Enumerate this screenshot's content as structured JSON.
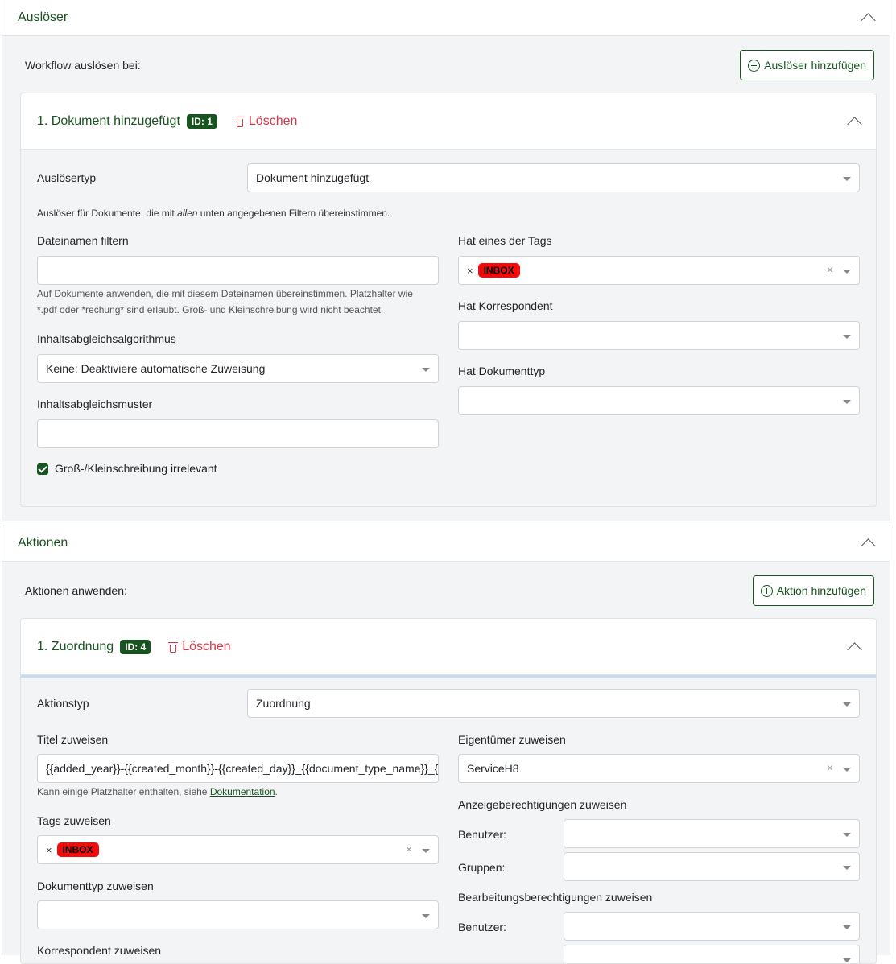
{
  "triggers_section": {
    "title": "Auslöser",
    "lead": "Workflow auslösen bei:",
    "add_button": "Auslöser hinzufügen",
    "card": {
      "title": "1. Dokument hinzugefügt",
      "id_badge": "ID: 1",
      "delete_label": "Löschen",
      "trigger_type_label": "Auslösertyp",
      "trigger_type_value": "Dokument hinzugefügt",
      "help_prefix": "Auslöser für Dokumente, die mit ",
      "help_emph": "allen",
      "help_suffix": " unten angegebenen Filtern übereinstimmen.",
      "filename_label": "Dateinamen filtern",
      "filename_value": "",
      "filename_help_1": "Auf Dokumente anwenden, die mit diesem Dateinamen übereinstimmen. Platzhalter wie",
      "filename_help_2": "*.pdf oder *rechung* sind erlaubt. Groß- und Kleinschreibung wird nicht beachtet.",
      "algorithm_label": "Inhaltsabgleichsalgorithmus",
      "algorithm_value": "Keine: Deaktiviere automatische Zuweisung",
      "pattern_label": "Inhaltsabgleichsmuster",
      "pattern_value": "",
      "case_label": "Groß-/Kleinschreibung irrelevant",
      "case_checked": true,
      "tags_label": "Hat eines der Tags",
      "tag_value": "INBOX",
      "tag_color": "#f50a0a",
      "correspondent_label": "Hat Korrespondent",
      "doctype_label": "Hat Dokumenttyp"
    }
  },
  "actions_section": {
    "title": "Aktionen",
    "lead": "Aktionen anwenden:",
    "add_button": "Aktion hinzufügen",
    "card": {
      "title": "1. Zuordnung",
      "id_badge": "ID: 4",
      "delete_label": "Löschen",
      "action_type_label": "Aktionstyp",
      "action_type_value": "Zuordnung",
      "title_label": "Titel zuweisen",
      "title_value": "{{added_year}}-{{created_month}}-{{created_day}}_{{document_type_name}}_{{",
      "title_help_prefix": "Kann einige Platzhalter enthalten, siehe ",
      "title_help_link": "Dokumentation",
      "title_help_suffix": ".",
      "tags_label": "Tags zuweisen",
      "tag_value": "INBOX",
      "doctype_label": "Dokumenttyp zuweisen",
      "correspondent_label": "Korrespondent zuweisen",
      "owner_label": "Eigentümer zuweisen",
      "owner_value": "ServiceH8",
      "view_perm_label": "Anzeigeberechtigungen zuweisen",
      "edit_perm_label": "Bearbeitungsberechtigungen zuweisen",
      "users_label": "Benutzer:",
      "groups_label": "Gruppen:"
    }
  },
  "colors": {
    "accent": "#17541f",
    "danger": "#dc3545",
    "panel_bg": "#f3f4f5"
  }
}
